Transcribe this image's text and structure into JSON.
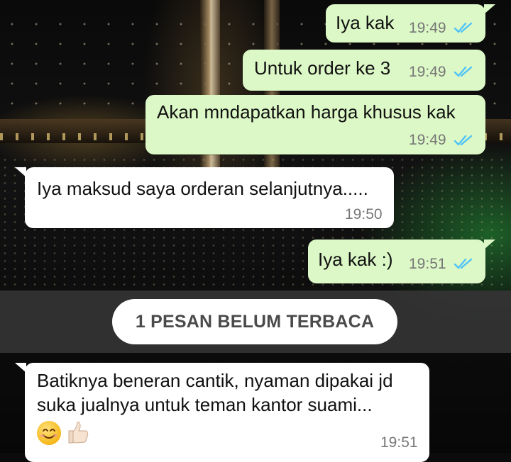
{
  "messages": [
    {
      "direction": "outgoing",
      "text": "Iya kak",
      "time": "19:49",
      "status": "read",
      "status_icon": "double-check-icon",
      "status_color": "#4fc3f7"
    },
    {
      "direction": "outgoing",
      "text": "Untuk order ke 3",
      "time": "19:49",
      "status": "read",
      "status_icon": "double-check-icon",
      "status_color": "#4fc3f7"
    },
    {
      "direction": "outgoing",
      "text": "Akan mndapatkan harga khusus kak",
      "time": "19:49",
      "status": "read",
      "status_icon": "double-check-icon",
      "status_color": "#4fc3f7"
    },
    {
      "direction": "incoming",
      "text": "Iya maksud saya orderan selanjutnya.....",
      "time": "19:50"
    },
    {
      "direction": "outgoing",
      "text": "Iya kak :)",
      "time": "19:51",
      "status": "read",
      "status_icon": "double-check-icon",
      "status_color": "#4fc3f7"
    }
  ],
  "unread_divider": {
    "label": "1 PESAN BELUM TERBACA"
  },
  "unread_message": {
    "direction": "incoming",
    "line1": "Batiknya beneran cantik, nyaman dipakai jd",
    "line2": "suka jualnya untuk teman kantor suami...",
    "emojis": [
      "smiling-face-icon",
      "thumbs-up-icon"
    ],
    "time": "19:51"
  },
  "colors": {
    "outgoing_bubble": "#dcf8c6",
    "incoming_bubble": "#ffffff",
    "read_ticks": "#4fc3f7",
    "divider_bar": "#343434"
  }
}
